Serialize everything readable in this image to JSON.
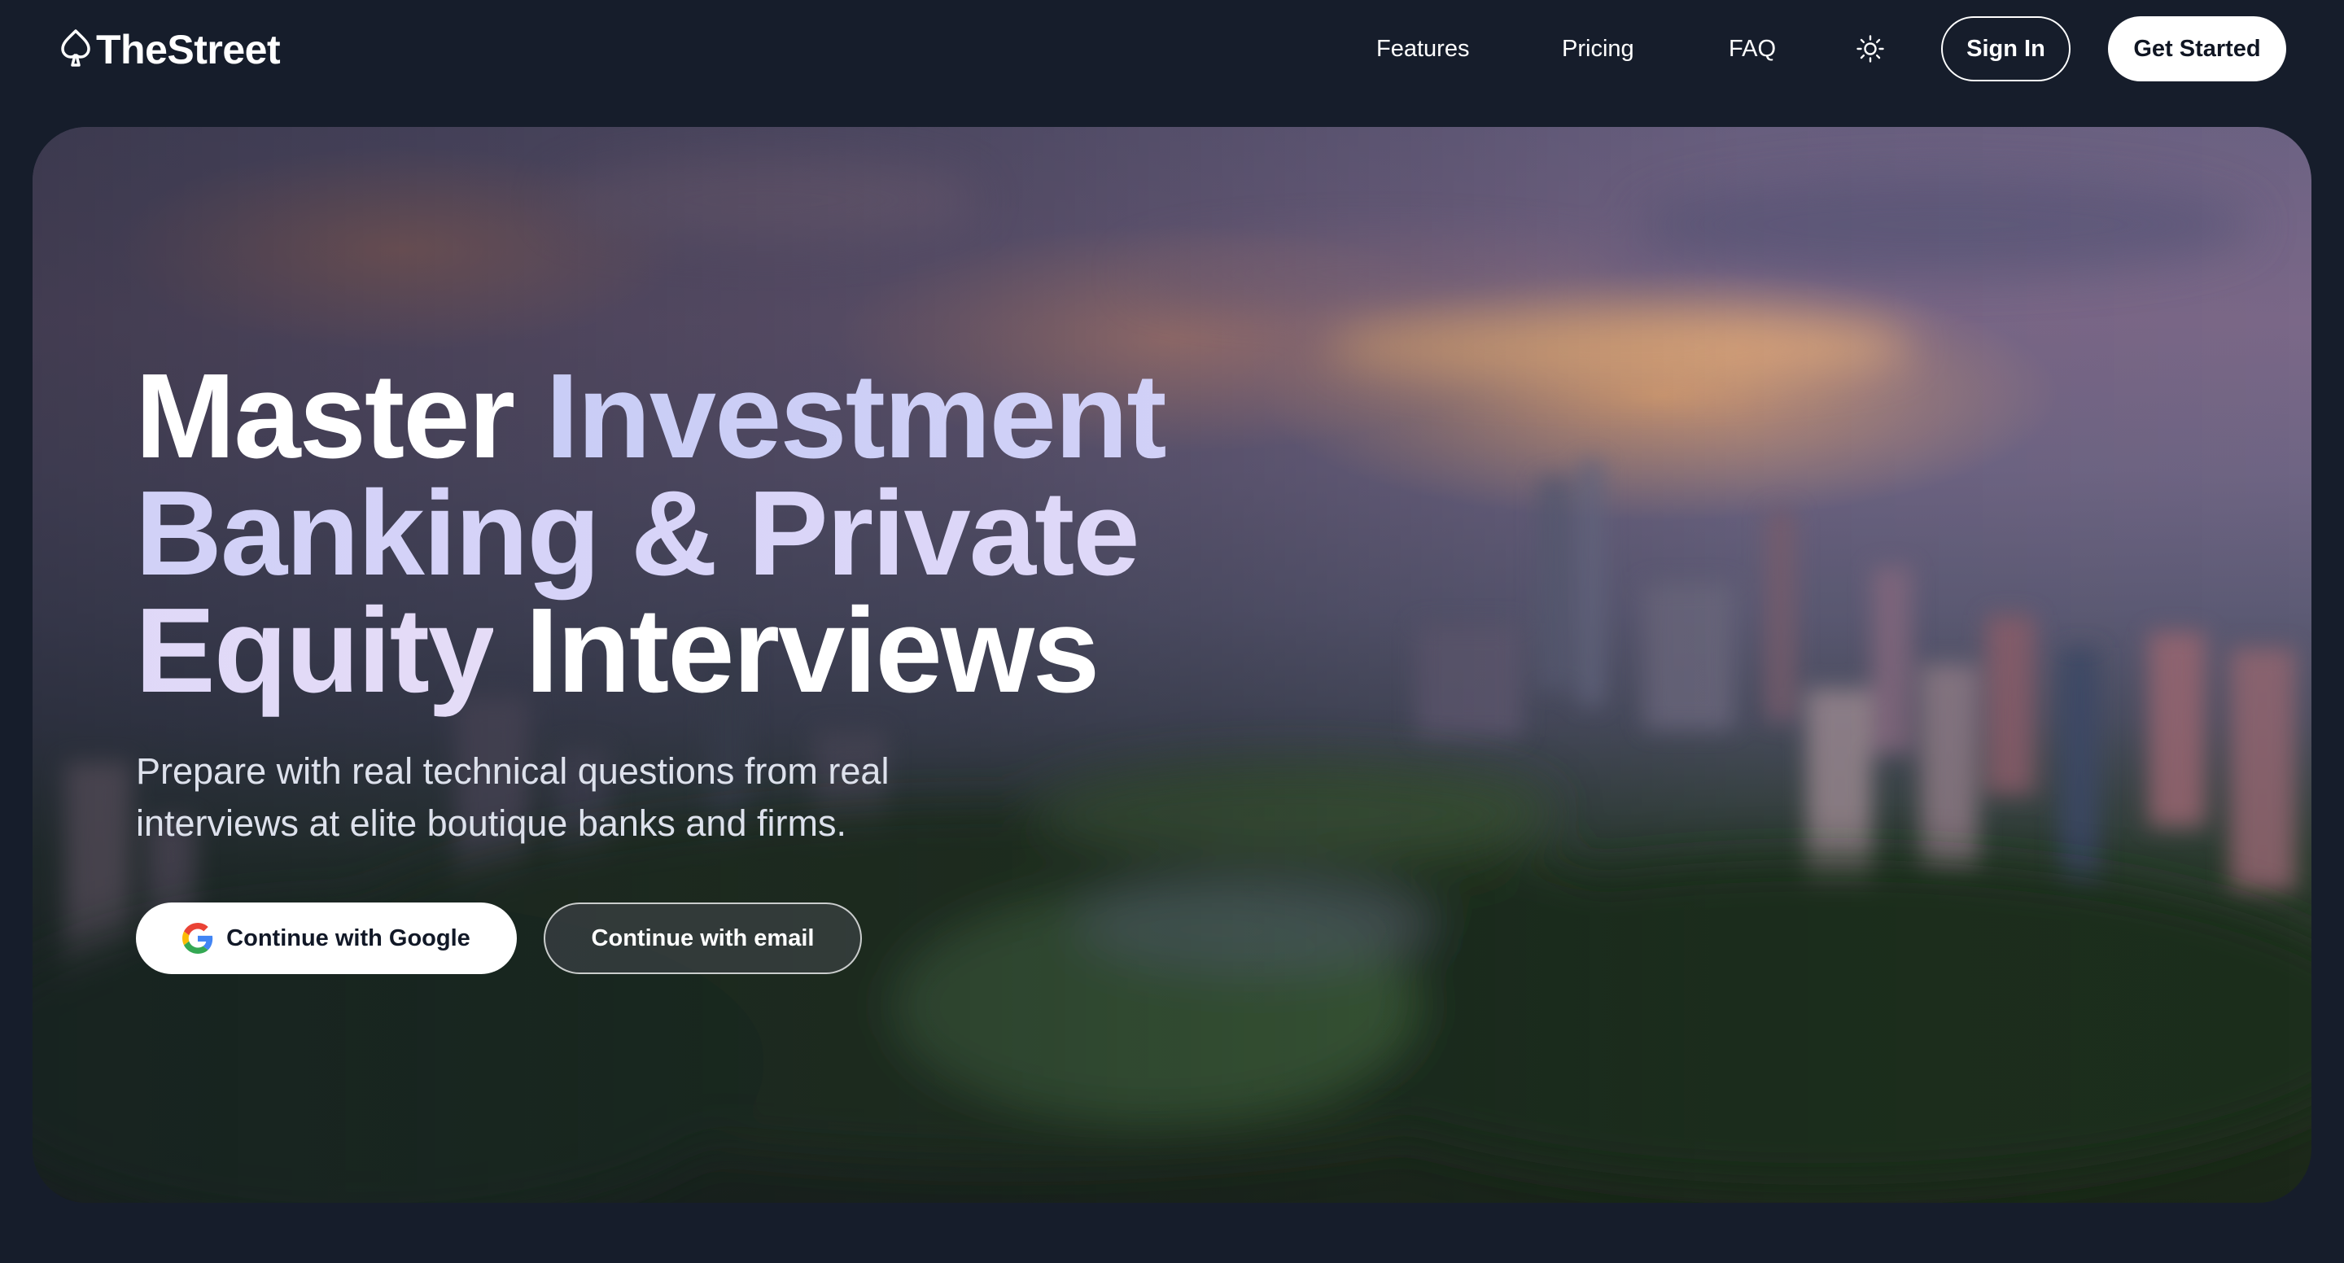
{
  "brand": {
    "name": "TheStreet",
    "logo_icon": "spade-icon"
  },
  "nav": {
    "items": [
      {
        "label": "Features"
      },
      {
        "label": "Pricing"
      },
      {
        "label": "FAQ"
      }
    ],
    "theme_toggle_icon": "sun-icon",
    "sign_in_label": "Sign In",
    "get_started_label": "Get Started"
  },
  "hero": {
    "title_parts": [
      {
        "text": "Master",
        "style": "white"
      },
      {
        "text": "Investment Banking & Private Equity",
        "style": "accent"
      },
      {
        "text": "Interviews",
        "style": "white"
      }
    ],
    "subtitle": "Prepare with real technical questions from real interviews at elite boutique banks and firms.",
    "google_button_label": "Continue with Google",
    "google_icon": "google-icon",
    "email_button_label": "Continue with email"
  },
  "colors": {
    "page_background": "#161d2b",
    "accent_text_start": "#c9cdf6",
    "accent_text_end": "#e5dcf7",
    "primary_button": "#ffffff"
  }
}
